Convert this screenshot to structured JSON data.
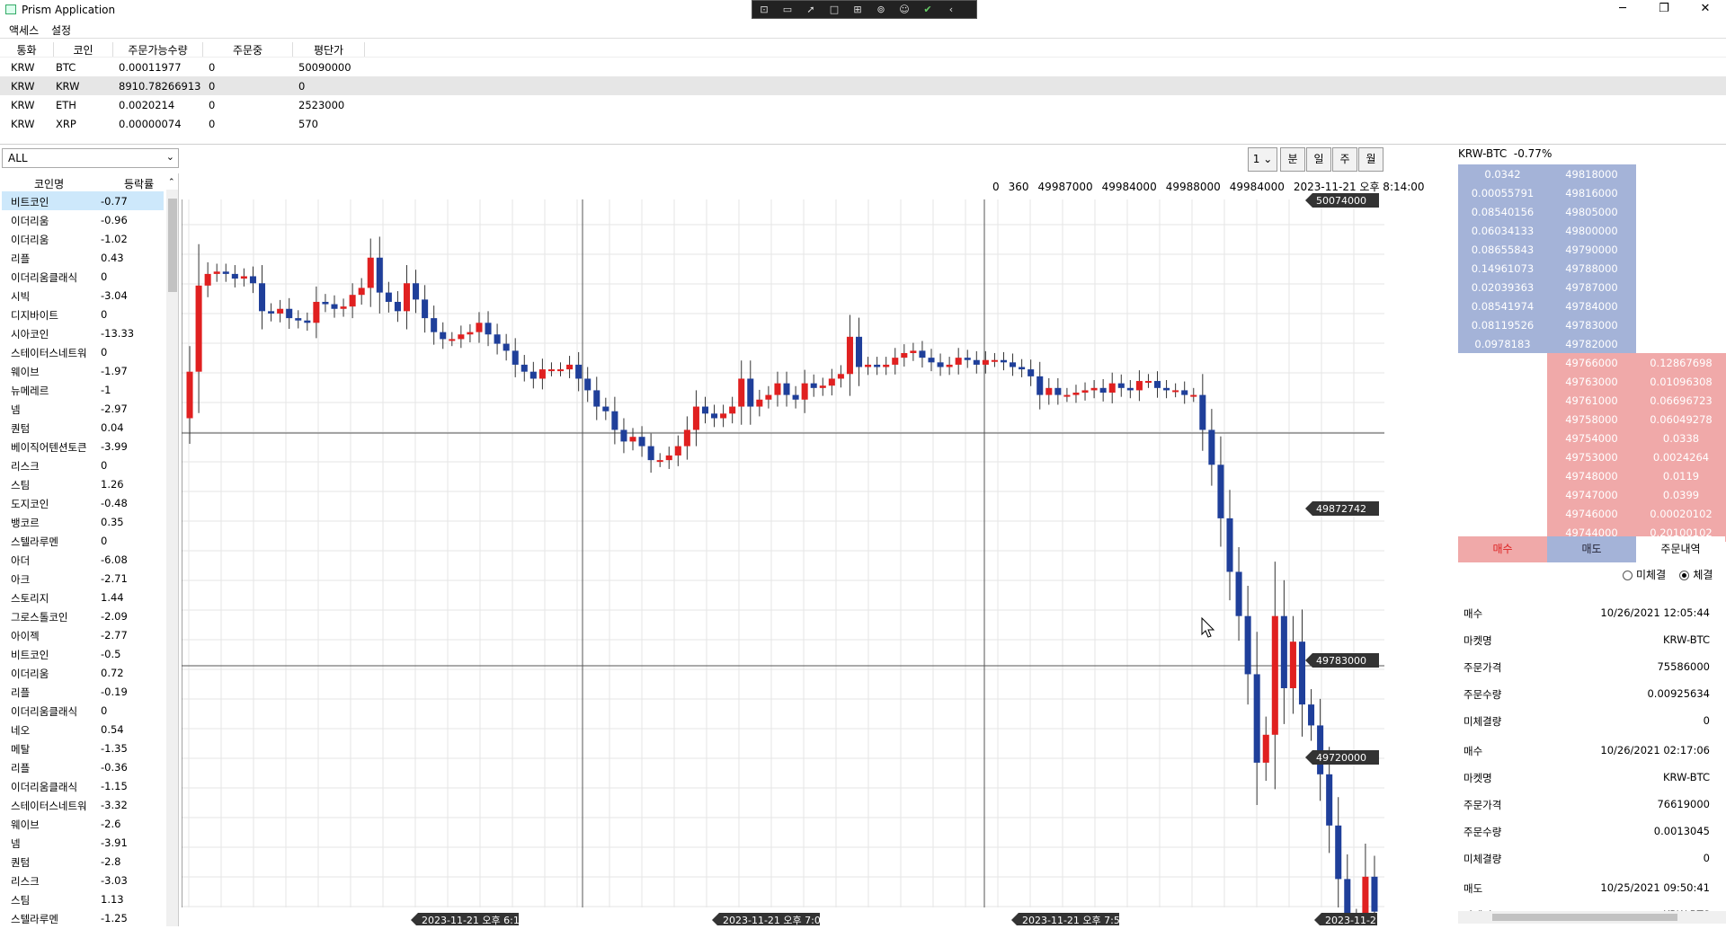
{
  "window": {
    "title": "Prism Application"
  },
  "devtools": {
    "icons": [
      "select-element-icon",
      "video-icon",
      "cursor-icon",
      "box-icon",
      "layout-icon",
      "binding-icon",
      "accessibility-icon",
      "check-icon",
      "collapse-icon"
    ]
  },
  "menu": {
    "items": [
      "액세스",
      "설정"
    ]
  },
  "holdings": {
    "columns": [
      "통화",
      "코인",
      "주문가능수량",
      "주문중",
      "평단가"
    ],
    "rows": [
      {
        "currency": "KRW",
        "coin": "BTC",
        "available": "0.00011977",
        "pending": "0",
        "avg": "50090000"
      },
      {
        "currency": "KRW",
        "coin": "KRW",
        "available": "8910.78266913",
        "pending": "0",
        "avg": "0"
      },
      {
        "currency": "KRW",
        "coin": "ETH",
        "available": "0.0020214",
        "pending": "0",
        "avg": "2523000"
      },
      {
        "currency": "KRW",
        "coin": "XRP",
        "available": "0.00000074",
        "pending": "0",
        "avg": "570"
      }
    ],
    "selected_index": 1
  },
  "filter": {
    "value": "ALL"
  },
  "coin_list": {
    "columns": [
      "코인명",
      "등락률"
    ],
    "items": [
      {
        "name": "비트코인",
        "change": "-0.77"
      },
      {
        "name": "이더리움",
        "change": "-0.96"
      },
      {
        "name": "이더리움",
        "change": "-1.02"
      },
      {
        "name": "리플",
        "change": "0.43"
      },
      {
        "name": "이더리움클래식",
        "change": "0"
      },
      {
        "name": "시빅",
        "change": "-3.04"
      },
      {
        "name": "디지바이트",
        "change": "0"
      },
      {
        "name": "시아코인",
        "change": "-13.33"
      },
      {
        "name": "스테이터스네트워",
        "change": "0"
      },
      {
        "name": "웨이브",
        "change": "-1.97"
      },
      {
        "name": "뉴메레르",
        "change": "-1"
      },
      {
        "name": "넴",
        "change": "-2.97"
      },
      {
        "name": "퀀텀",
        "change": "0.04"
      },
      {
        "name": "베이직어텐션토큰",
        "change": "-3.99"
      },
      {
        "name": "리스크",
        "change": "0"
      },
      {
        "name": "스팀",
        "change": "1.26"
      },
      {
        "name": "도지코인",
        "change": "-0.48"
      },
      {
        "name": "뱅코르",
        "change": "0.35"
      },
      {
        "name": "스텔라루멘",
        "change": "0"
      },
      {
        "name": "아더",
        "change": "-6.08"
      },
      {
        "name": "아크",
        "change": "-2.71"
      },
      {
        "name": "스토리지",
        "change": "1.44"
      },
      {
        "name": "그로스톨코인",
        "change": "-2.09"
      },
      {
        "name": "아이젝",
        "change": "-2.77"
      },
      {
        "name": "비트코인",
        "change": "-0.5"
      },
      {
        "name": "이더리움",
        "change": "0.72"
      },
      {
        "name": "리플",
        "change": "-0.19"
      },
      {
        "name": "이더리움클래식",
        "change": "0"
      },
      {
        "name": "네오",
        "change": "0.54"
      },
      {
        "name": "메탈",
        "change": "-1.35"
      },
      {
        "name": "리플",
        "change": "-0.36"
      },
      {
        "name": "이더리움클래식",
        "change": "-1.15"
      },
      {
        "name": "스테이터스네트워",
        "change": "-3.32"
      },
      {
        "name": "웨이브",
        "change": "-2.6"
      },
      {
        "name": "넴",
        "change": "-3.91"
      },
      {
        "name": "퀀텀",
        "change": "-2.8"
      },
      {
        "name": "리스크",
        "change": "-3.03"
      },
      {
        "name": "스팀",
        "change": "1.13"
      },
      {
        "name": "스텔라루멘",
        "change": "-1.25"
      }
    ],
    "selected_index": 0
  },
  "chart_controls": {
    "interval": "1",
    "timeframes": [
      "분",
      "일",
      "주",
      "월"
    ]
  },
  "chart_info": {
    "values": [
      "0",
      "360",
      "49987000",
      "49984000",
      "49988000",
      "49984000",
      "2023-11-21 오후 8:14:00"
    ]
  },
  "chart_data": {
    "type": "candlestick",
    "title": "",
    "ylim": [
      49720000,
      50074000
    ],
    "price_tags": [
      "50074000",
      "49872742",
      "49783000",
      "49720000"
    ],
    "time_labels": [
      "2023-11-21 오후 6:14:00",
      "2023-11-21 오후 7:04:00",
      "2023-11-21 오후 7:54:00",
      "2023-11-21"
    ],
    "crosshair_price": 49872742,
    "up_color": "#e02020",
    "down_color": "#1f3f9a",
    "closes": [
      50000000,
      50037000,
      50042000,
      50043000,
      50042000,
      50040000,
      50041000,
      50038000,
      50026000,
      50025000,
      50027000,
      50023000,
      50022000,
      50021000,
      50030000,
      50029000,
      50027000,
      50028000,
      50033000,
      50036000,
      50049000,
      50034000,
      50030000,
      50026000,
      50038000,
      50031000,
      50023000,
      50017000,
      50014000,
      50014000,
      50016000,
      50017000,
      50021000,
      50016000,
      50012000,
      50009000,
      50003000,
      50000000,
      49997000,
      50001000,
      50001000,
      50001000,
      50003000,
      49997000,
      49992000,
      49985000,
      49983000,
      49975000,
      49970000,
      49972000,
      49968000,
      49962000,
      49962000,
      49964000,
      49968000,
      49975000,
      49985000,
      49982000,
      49980000,
      49982000,
      49985000,
      49997000,
      49985000,
      49988000,
      49990000,
      49995000,
      49990000,
      49988000,
      49995000,
      49993000,
      49994000,
      49997000,
      49999000,
      50015000,
      50002000,
      50003000,
      50002000,
      50003000,
      50006000,
      50008000,
      50009000,
      50006000,
      50004000,
      50002000,
      50003000,
      50006000,
      50005000,
      50003000,
      50005000,
      50005000,
      50004000,
      50002000,
      50001000,
      49998000,
      49990000,
      49993000,
      49990000,
      49990000,
      49991000,
      49992000,
      49993000,
      49991000,
      49995000,
      49993000,
      49992000,
      49996000,
      49996000,
      49993000,
      49992000,
      49992000,
      49990000,
      49990000,
      49975000,
      49960000,
      49937000,
      49914000,
      49895000,
      49870000,
      49832000,
      49844000,
      49895000,
      49864000,
      49884000,
      49857000,
      49848000,
      49827000,
      49805000,
      49782000,
      49763000,
      49755000,
      49783000,
      49768000
    ]
  },
  "orderbook": {
    "market": "KRW-BTC",
    "change": "-0.77%",
    "bids": [
      {
        "qty": "0.0342",
        "price": "49818000"
      },
      {
        "qty": "0.00055791",
        "price": "49816000"
      },
      {
        "qty": "0.08540156",
        "price": "49805000"
      },
      {
        "qty": "0.06034133",
        "price": "49800000"
      },
      {
        "qty": "0.08655843",
        "price": "49790000"
      },
      {
        "qty": "0.14961073",
        "price": "49788000"
      },
      {
        "qty": "0.02039363",
        "price": "49787000"
      },
      {
        "qty": "0.08541974",
        "price": "49784000"
      },
      {
        "qty": "0.08119526",
        "price": "49783000"
      },
      {
        "qty": "0.0978183",
        "price": "49782000"
      }
    ],
    "asks": [
      {
        "price": "49766000",
        "qty": "0.12867698"
      },
      {
        "price": "49763000",
        "qty": "0.01096308"
      },
      {
        "price": "49761000",
        "qty": "0.06696723"
      },
      {
        "price": "49758000",
        "qty": "0.06049278"
      },
      {
        "price": "49754000",
        "qty": "0.0338"
      },
      {
        "price": "49753000",
        "qty": "0.0024264"
      },
      {
        "price": "49748000",
        "qty": "0.0119"
      },
      {
        "price": "49747000",
        "qty": "0.0399"
      },
      {
        "price": "49746000",
        "qty": "0.00020102"
      },
      {
        "price": "49744000",
        "qty": "0.20100102"
      }
    ],
    "bid_color": "#a4b3d8",
    "ask_color": "#f0a9a9"
  },
  "order_tabs": {
    "buy": "매수",
    "sell": "매도",
    "history": "주문내역"
  },
  "order_filter": {
    "options": [
      "미체결",
      "체결"
    ],
    "selected": "체결"
  },
  "history": {
    "labels": {
      "market": "마켓명",
      "price": "주문가격",
      "qty": "주문수량",
      "unfilled": "미체결량"
    },
    "records": [
      {
        "side": "매수",
        "time": "10/26/2021 12:05:44",
        "market": "KRW-BTC",
        "price": "75586000",
        "qty": "0.00925634",
        "unfilled": "0"
      },
      {
        "side": "매수",
        "time": "10/26/2021 02:17:06",
        "market": "KRW-BTC",
        "price": "76619000",
        "qty": "0.0013045",
        "unfilled": "0"
      },
      {
        "side": "매도",
        "time": "10/25/2021 09:50:41",
        "market": "KRW-BTC",
        "price": "",
        "qty": "",
        "unfilled": ""
      }
    ]
  }
}
